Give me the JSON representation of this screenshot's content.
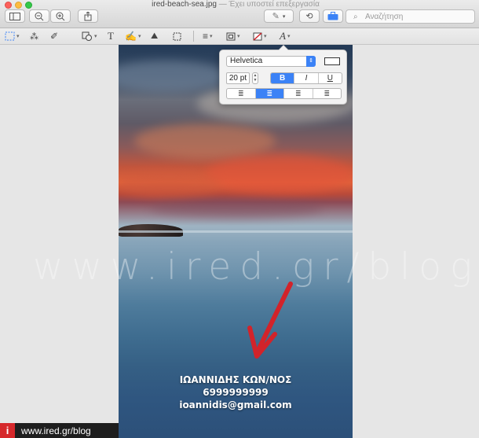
{
  "window": {
    "filename": "ired-beach-sea.jpg",
    "separator": "—",
    "edited_status": "Έχει υποστεί επεξεργασία"
  },
  "toolbar": {
    "search_placeholder": "Αναζήτηση"
  },
  "font_popover": {
    "font_name": "Helvetica",
    "font_size": "20 pt",
    "bold_label": "B",
    "italic_label": "I",
    "underline_label": "U",
    "selected_style": "bold",
    "selected_alignment": "center",
    "text_color": "#ffffff"
  },
  "document": {
    "card_name": "ΙΩΑΝΝΙΔΗΣ ΚΩΝ/ΝΟΣ",
    "card_phone": "6999999999",
    "card_email": "ioannidis@gmail.com",
    "arrow_color": "#d2232a"
  },
  "watermark": {
    "text": "www.ired.gr/blog",
    "badge_logo": "i",
    "badge_url": "www.ired.gr/blog"
  },
  "colors": {
    "accent": "#3b82f6",
    "close": "#fc605b",
    "minimize": "#fdbc40",
    "maximize": "#34c84a"
  }
}
